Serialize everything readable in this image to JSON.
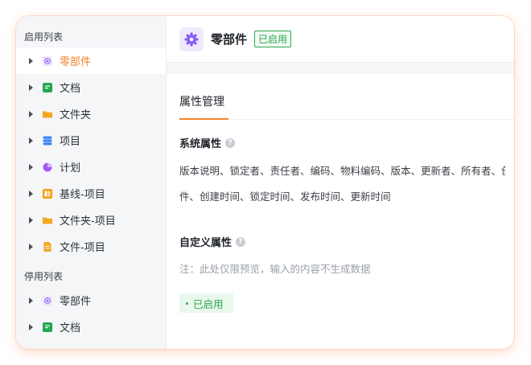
{
  "sidebar": {
    "enabled_title": "启用列表",
    "enabled_items": [
      {
        "label": "零部件",
        "icon": "gear-icon",
        "color": "#8b5cf6"
      },
      {
        "label": "文档",
        "icon": "document-icon",
        "color": "#22a652"
      },
      {
        "label": "文件夹",
        "icon": "folder-icon",
        "color": "#f5a623"
      },
      {
        "label": "项目",
        "icon": "stack-icon",
        "color": "#3b82f6"
      },
      {
        "label": "计划",
        "icon": "pie-icon",
        "color": "#a855f7"
      },
      {
        "label": "基线-项目",
        "icon": "baseline-icon",
        "color": "#f59e0b"
      },
      {
        "label": "文件夹-项目",
        "icon": "folder-icon",
        "color": "#f5a623"
      },
      {
        "label": "文件-项目",
        "icon": "file-icon",
        "color": "#f5a623"
      }
    ],
    "disabled_title": "停用列表",
    "disabled_items": [
      {
        "label": "零部件",
        "icon": "gear-icon",
        "color": "#8b5cf6"
      },
      {
        "label": "文档",
        "icon": "document-icon",
        "color": "#22a652"
      }
    ]
  },
  "header": {
    "title": "零部件",
    "badge": "已启用",
    "icon": "gear-icon",
    "icon_color": "#8b5cf6"
  },
  "main": {
    "tab_title": "属性管理",
    "system_title": "系统属性",
    "system_attrs_line1": "版本说明、锁定者、责任者、编码、物料编码、版本、更新者、所有者、创建者、附",
    "system_attrs_line2": "件、创建时间、锁定时间、发布时间、更新时间",
    "custom_title": "自定义属性",
    "custom_note": "注：此处仅限预览，输入的内容不生成数据",
    "status_tag": "已启用",
    "help_glyph": "?"
  },
  "colors": {
    "accent": "#f0832a",
    "success": "#2ea84d"
  }
}
